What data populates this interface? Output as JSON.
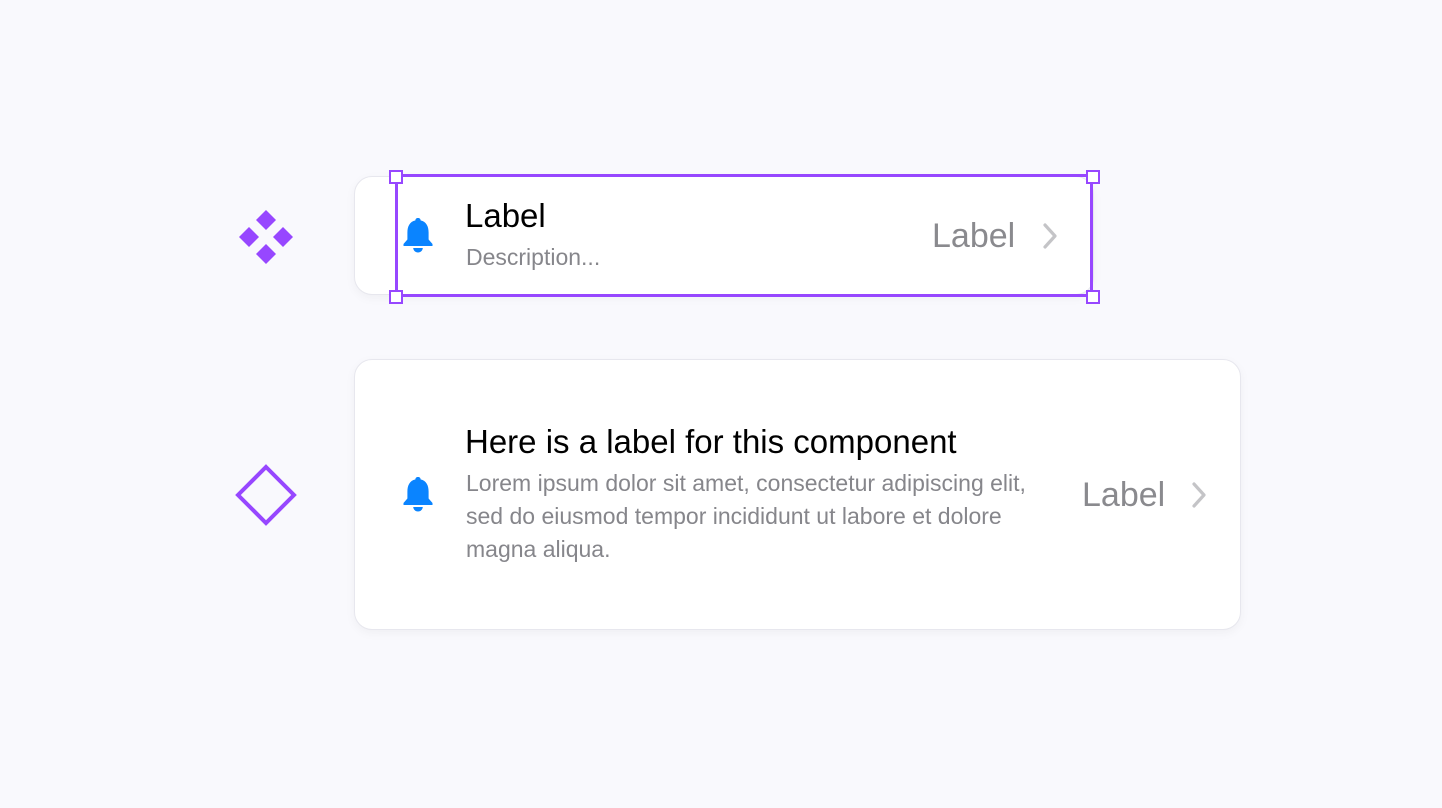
{
  "symbols": {
    "main_component_icon": "main-component-icon",
    "instance_icon": "component-instance-icon"
  },
  "cells": [
    {
      "icon": "bell-icon",
      "title": "Label",
      "description": "Description...",
      "value": "Label",
      "accessory": "chevron-right-icon",
      "selected": true
    },
    {
      "icon": "bell-icon",
      "title": "Here is a label for this component",
      "description": "Lorem ipsum dolor sit amet, consectetur adipiscing elit, sed do eiusmod tempor incididunt ut labore et dolore magna aliqua.",
      "value": "Label",
      "accessory": "chevron-right-icon",
      "selected": false
    }
  ],
  "colors": {
    "background": "#f9f9fd",
    "accent_purple": "#9747ff",
    "icon_blue": "#0a84ff",
    "title_text": "#000000",
    "secondary_text": "#86868b",
    "chevron": "#c4c4c7"
  }
}
